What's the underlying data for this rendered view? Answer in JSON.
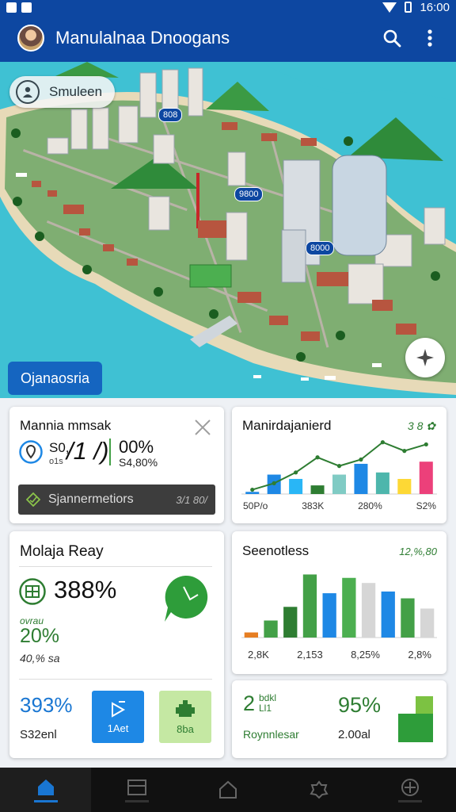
{
  "status_bar": {
    "time": "16:00"
  },
  "app_bar": {
    "title": "Manulalnaa Dnoogans"
  },
  "map": {
    "user_chip": "Smuleen",
    "location_chip": "Ojanaosria",
    "pins": [
      "808",
      "9800",
      "8000"
    ]
  },
  "cards": {
    "card1": {
      "title": "Mannia mmsak",
      "stat_a_top": "S0,",
      "stat_a_bottom": "o1s",
      "big_value": "/1 /)",
      "stat_b_top": "00%",
      "stat_b_bottom": "S4,80%",
      "banner_label": "Sjannermetiors",
      "banner_value": "3/1 80/"
    },
    "card2": {
      "title": "Manirdajanierd",
      "badge": "3 8 ✿",
      "x_labels": [
        "50P/o",
        "383K",
        "280%",
        "S2%"
      ]
    },
    "card3": {
      "title": "Molaja Reay",
      "big_value": "388%",
      "green_label": "ovrau",
      "green_value": "20%",
      "sub_value": "40,% sa",
      "bottom_value": "393%",
      "bottom_label": "S32enl",
      "tile1_label": "1Aet",
      "tile2_label": "8ba"
    },
    "card4": {
      "title": "Seenotless",
      "badge": "12,%,80",
      "x_labels": [
        "2,8K",
        "2,153",
        "8,25%",
        "2,8%"
      ]
    },
    "card5": {
      "value_left": "2",
      "value_left_side": "bdkl Ll1",
      "label_left": "Roynnlesar",
      "value_right": "95%",
      "label_right": "2.00al"
    }
  },
  "chart_data": [
    {
      "type": "bar",
      "title": "Manirdajanierd",
      "categories": [
        "1",
        "2",
        "3",
        "4",
        "5",
        "6",
        "7",
        "8",
        "9"
      ],
      "values": [
        2,
        18,
        14,
        8,
        18,
        28,
        20,
        14,
        30
      ],
      "colors": [
        "#1e88e5",
        "#1e88e5",
        "#29b6f6",
        "#2e7d32",
        "#80cbc4",
        "#1e88e5",
        "#4db6ac",
        "#fdd835",
        "#ec407a"
      ],
      "line": [
        4,
        10,
        20,
        34,
        26,
        32,
        48,
        40,
        46
      ],
      "x_tick_labels": [
        "50P/o",
        "383K",
        "280%",
        "S2%"
      ]
    },
    {
      "type": "bar",
      "title": "Seenotless",
      "categories": [
        "1",
        "2",
        "3",
        "4",
        "5",
        "6",
        "7",
        "8",
        "9",
        "10"
      ],
      "values": [
        3,
        10,
        18,
        37,
        26,
        35,
        32,
        27,
        23,
        17
      ],
      "colors": [
        "#e67e22",
        "#43a047",
        "#2e7d32",
        "#43a047",
        "#1e88e5",
        "#4caf50",
        "#d6d6d6",
        "#1e88e5",
        "#43a047",
        "#d6d6d6"
      ],
      "x_tick_labels": [
        "2,8K",
        "2,153",
        "8,25%",
        "2,8%"
      ]
    }
  ]
}
